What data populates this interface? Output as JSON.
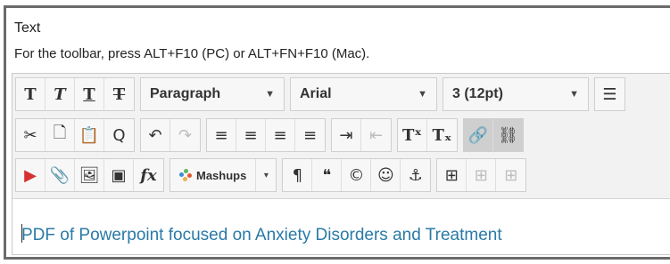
{
  "field": {
    "label": "Text",
    "hint": "For the toolbar, press ALT+F10 (PC) or ALT+FN+F10 (Mac)."
  },
  "toolbar": {
    "row1": {
      "bold": "T",
      "italic": "T",
      "underline": "T",
      "strikethrough": "T",
      "paragraph_format": "Paragraph",
      "font_family": "Arial",
      "font_size": "3 (12pt)",
      "more": "☰"
    },
    "row2": {
      "cut": "✂",
      "copy": "🗋",
      "paste": "📋",
      "find": "Q",
      "undo": "↶",
      "redo": "↷",
      "align_left": "≡",
      "align_center": "≡",
      "align_right": "≡",
      "justify": "≡",
      "indent": "⇥",
      "outdent": "⇤",
      "superscript": "Tˣ",
      "subscript": "Tₓ",
      "link": "🔗",
      "unlink": "⛓"
    },
    "row3": {
      "youtube": "▶",
      "attach": "📎",
      "image": "🖼",
      "media": "▣",
      "math": "fx",
      "mashups": "Mashups",
      "mashups_arrow": "▾",
      "paragraph_mark": "¶",
      "quote": "❝",
      "copyright": "©",
      "emoji": "☺",
      "anchor": "⚓",
      "table": "⊞",
      "table_props": "⊞",
      "table_cell": "⊞"
    }
  },
  "editor": {
    "content": "PDF of Powerpoint focused on Anxiety Disorders and Treatment"
  },
  "colors": {
    "frame_border": "#6a6a6a",
    "content_text": "#2a7aa6",
    "youtube_red": "#d63030"
  }
}
